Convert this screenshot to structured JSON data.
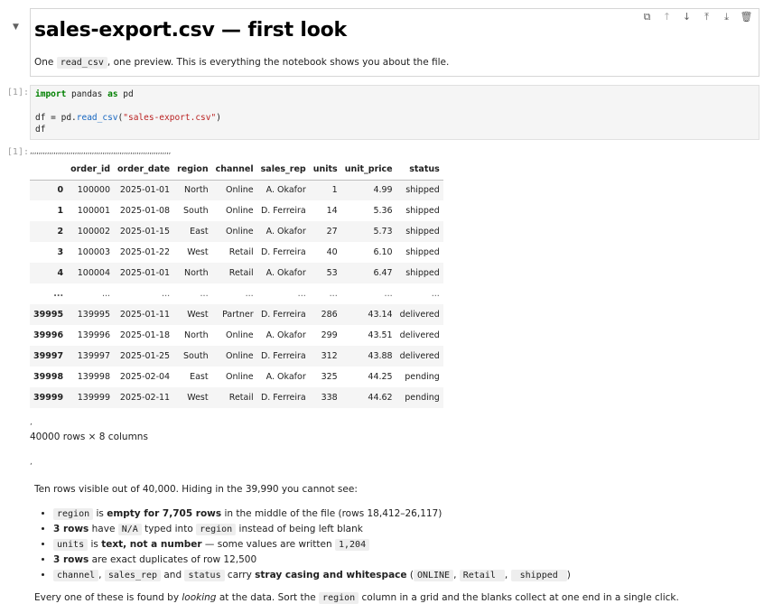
{
  "title_cell": {
    "title": "sales-export.csv — first look",
    "desc_pre": "One ",
    "desc_code": "read_csv",
    "desc_post": ", one preview. This is everything the notebook shows you about the file."
  },
  "code_cell": {
    "prompt": "[1]:",
    "lines": {
      "kw_import": "import",
      "mod": " pandas ",
      "kw_as": "as",
      "alias": " pd",
      "l2_pre": "df = pd.",
      "l2_fn": "read_csv",
      "l2_open": "(",
      "l2_str": "\"sales-export.csv\"",
      "l2_close": ")",
      "l3": "df"
    }
  },
  "output": {
    "prompt": "[1]:",
    "ticks": ",,,,,,,,,,,,,,,,,,,,,,,,,,,,,,,,,,,,,,,,,,,,,,,,,,,,,,,,,,,,,,,,,,",
    "comma": ",",
    "shape": "40000 rows × 8 columns"
  },
  "df": {
    "columns": [
      "",
      "order_id",
      "order_date",
      "region",
      "channel",
      "sales_rep",
      "units",
      "unit_price",
      "status"
    ],
    "rows": [
      [
        "0",
        "100000",
        "2025-01-01",
        "North",
        "Online",
        "A. Okafor",
        "1",
        "4.99",
        "shipped"
      ],
      [
        "1",
        "100001",
        "2025-01-08",
        "South",
        "Online",
        "D. Ferreira",
        "14",
        "5.36",
        "shipped"
      ],
      [
        "2",
        "100002",
        "2025-01-15",
        "East",
        "Online",
        "A. Okafor",
        "27",
        "5.73",
        "shipped"
      ],
      [
        "3",
        "100003",
        "2025-01-22",
        "West",
        "Retail",
        "D. Ferreira",
        "40",
        "6.10",
        "shipped"
      ],
      [
        "4",
        "100004",
        "2025-01-01",
        "North",
        "Retail",
        "A. Okafor",
        "53",
        "6.47",
        "shipped"
      ],
      [
        "...",
        "...",
        "...",
        "...",
        "...",
        "...",
        "...",
        "...",
        "..."
      ],
      [
        "39995",
        "139995",
        "2025-01-11",
        "West",
        "Partner",
        "D. Ferreira",
        "286",
        "43.14",
        "delivered"
      ],
      [
        "39996",
        "139996",
        "2025-01-18",
        "North",
        "Online",
        "A. Okafor",
        "299",
        "43.51",
        "delivered"
      ],
      [
        "39997",
        "139997",
        "2025-01-25",
        "South",
        "Online",
        "D. Ferreira",
        "312",
        "43.88",
        "delivered"
      ],
      [
        "39998",
        "139998",
        "2025-02-04",
        "East",
        "Online",
        "A. Okafor",
        "325",
        "44.25",
        "pending"
      ],
      [
        "39999",
        "139999",
        "2025-02-11",
        "West",
        "Retail",
        "D. Ferreira",
        "338",
        "44.62",
        "pending"
      ]
    ]
  },
  "notes": {
    "intro": "Ten rows visible out of 40,000. Hiding in the 39,990 you cannot see:",
    "b1": {
      "code": "region",
      "t1": " is ",
      "strong": "empty for 7,705 rows",
      "t2": " in the middle of the file (rows 18,412–26,117)"
    },
    "b2": {
      "strong": "3 rows",
      "t1": " have ",
      "code1": "N/A",
      "t2": " typed into ",
      "code2": "region",
      "t3": " instead of being left blank"
    },
    "b3": {
      "code1": "units",
      "t1": " is ",
      "strong": "text, not a number",
      "t2": " — some values are written ",
      "code2": "1,204"
    },
    "b4": {
      "strong": "3 rows",
      "t1": " are exact duplicates of row 12,500"
    },
    "b5": {
      "code1": "channel",
      "s1": ", ",
      "code2": "sales_rep",
      "s2": " and ",
      "code3": "status",
      "t1": " carry ",
      "strong": "stray casing and whitespace",
      "t2": " (",
      "code4": "ONLINE",
      "s3": ", ",
      "code5": "Retail ",
      "s4": ", ",
      "code6": " shipped ",
      "t3": ")"
    },
    "outro": {
      "pre": "Every one of these is found by ",
      "em": "looking",
      "mid": " at the data. Sort the ",
      "code": "region",
      "post": " column in a grid and the blanks collect at one end in a single click."
    }
  }
}
